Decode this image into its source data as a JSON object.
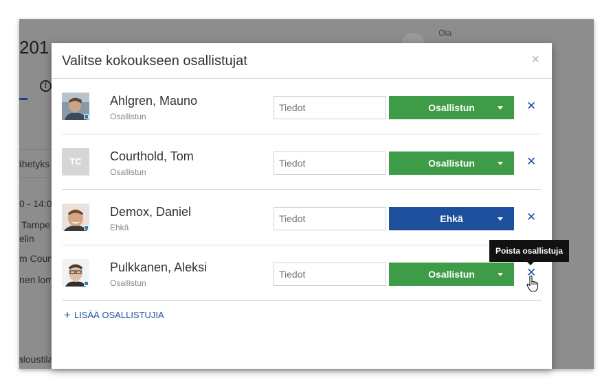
{
  "background": {
    "year_fragment": "201",
    "ota_label": "Ota",
    "lines": [
      "ähetyks",
      "0 - 14:0",
      "Tampe",
      "elin",
      "m Court",
      "nen lom",
      "aloustila"
    ]
  },
  "modal": {
    "title": "Valitse kokoukseen osallistujat",
    "close_label": "×",
    "notes_placeholder": "Tiedot",
    "remove_label": "✕",
    "participants": [
      {
        "name": "Ahlgren, Mauno",
        "status": "Osallistun",
        "rsvp": "Osallistun",
        "rsvp_color": "#3e9b47",
        "avatar": "photo",
        "initials": ""
      },
      {
        "name": "Courthold, Tom",
        "status": "Osallistun",
        "rsvp": "Osallistun",
        "rsvp_color": "#3e9b47",
        "avatar": "initials",
        "initials": "TC"
      },
      {
        "name": "Demox, Daniel",
        "status": "Ehkä",
        "rsvp": "Ehkä",
        "rsvp_color": "#1e4f9c",
        "avatar": "photo",
        "initials": ""
      },
      {
        "name": "Pulkkanen, Aleksi",
        "status": "Osallistun",
        "rsvp": "Osallistun",
        "rsvp_color": "#3e9b47",
        "avatar": "photo",
        "initials": ""
      }
    ],
    "add_plus": "+",
    "add_label": "LISÄÄ OSALLISTUJIA"
  },
  "tooltip": {
    "text": "Poista osallistuja"
  },
  "colors": {
    "accent_blue": "#1e4f9c",
    "accept_green": "#3e9b47",
    "overlay": "#8d8d8d"
  }
}
